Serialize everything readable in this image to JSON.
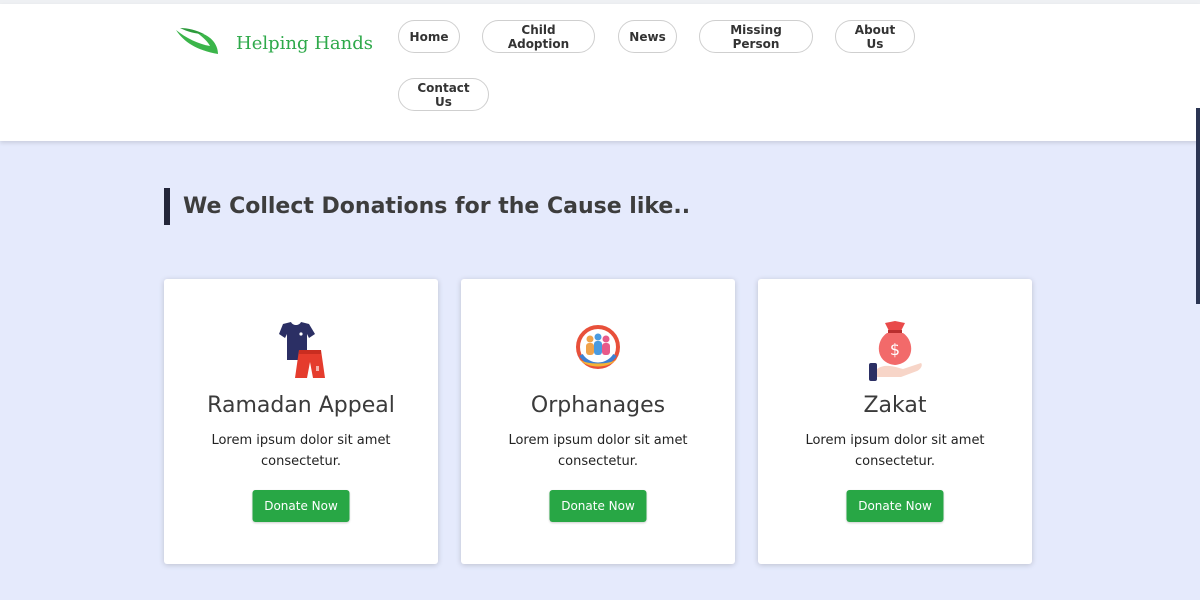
{
  "brand": {
    "name": "Helping Hands",
    "color": "#2ea94a"
  },
  "nav": {
    "items": [
      {
        "label": "Home"
      },
      {
        "label": "Child Adoption"
      },
      {
        "label": "News"
      },
      {
        "label": "Missing Person"
      },
      {
        "label": "About Us"
      },
      {
        "label": "Contact Us"
      }
    ]
  },
  "section": {
    "heading": "We Collect Donations for the Cause like.."
  },
  "cards": [
    {
      "title": "Ramadan Appeal",
      "icon": "clothes-icon",
      "description": "Lorem ipsum dolor sit amet consectetur.",
      "button": "Donate Now"
    },
    {
      "title": "Orphanages",
      "icon": "family-hands-icon",
      "description": "Lorem ipsum dolor sit amet consectetur.",
      "button": "Donate Now"
    },
    {
      "title": "Zakat",
      "icon": "money-bag-hand-icon",
      "description": "Lorem ipsum dolor sit amet consectetur.",
      "button": "Donate Now"
    }
  ],
  "colors": {
    "background": "#e5eafc",
    "accent_green": "#28a745",
    "heading_bar": "#23263a"
  }
}
